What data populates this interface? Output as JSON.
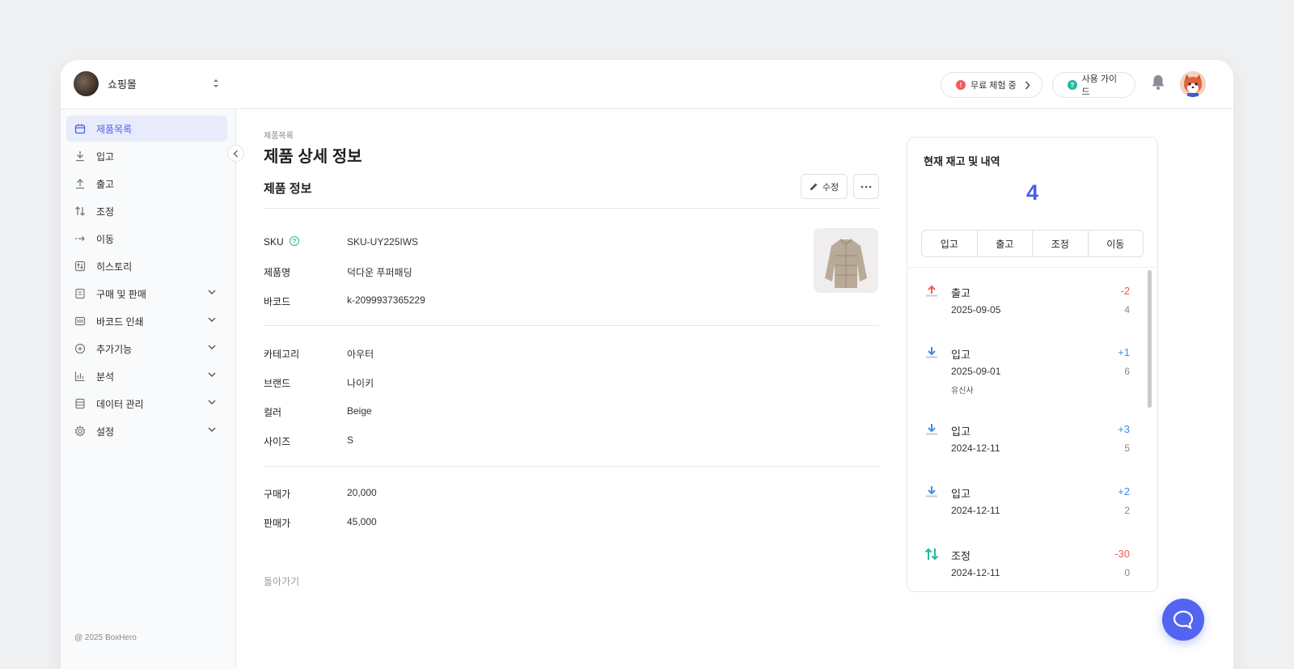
{
  "header": {
    "store_name": "쇼핑몰",
    "trial_label": "무료 체험 중",
    "guide_label": "사용 가이드"
  },
  "sidebar": {
    "items": [
      {
        "label": "제품목록",
        "icon": "box-icon"
      },
      {
        "label": "입고",
        "icon": "download-arrow-icon"
      },
      {
        "label": "출고",
        "icon": "upload-arrow-icon"
      },
      {
        "label": "조정",
        "icon": "adjust-arrows-icon"
      },
      {
        "label": "이동",
        "icon": "move-arrow-icon"
      },
      {
        "label": "히스토리",
        "icon": "history-icon"
      },
      {
        "label": "구매 및 판매",
        "icon": "document-icon"
      },
      {
        "label": "바코드 인쇄",
        "icon": "barcode-icon"
      },
      {
        "label": "추가기능",
        "icon": "plus-circle-icon"
      },
      {
        "label": "분석",
        "icon": "bar-chart-icon"
      },
      {
        "label": "데이터 관리",
        "icon": "database-icon"
      },
      {
        "label": "설정",
        "icon": "gear-icon"
      }
    ],
    "copyright": "@ 2025 BoxHero"
  },
  "main": {
    "breadcrumb": "제품목록",
    "page_title": "제품 상세 정보",
    "section_title": "제품 정보",
    "edit_label": "수정",
    "back_label": "돌아가기",
    "fields": {
      "sku": {
        "label": "SKU",
        "value": "SKU-UY225IWS"
      },
      "name": {
        "label": "제품명",
        "value": "덕다운 푸퍼패딩"
      },
      "barcode": {
        "label": "바코드",
        "value": "k-2099937365229"
      },
      "category": {
        "label": "카테고리",
        "value": "아우터"
      },
      "brand": {
        "label": "브랜드",
        "value": "나이키"
      },
      "color": {
        "label": "컬러",
        "value": "Beige"
      },
      "size": {
        "label": "사이즈",
        "value": "S"
      },
      "purchase_price": {
        "label": "구매가",
        "value": "20,000"
      },
      "sale_price": {
        "label": "판매가",
        "value": "45,000"
      }
    }
  },
  "stock": {
    "title": "현재 재고 및 내역",
    "quantity": "4",
    "actions": [
      "입고",
      "출고",
      "조정",
      "이동"
    ],
    "transactions": [
      {
        "type": "출고",
        "date": "2025-09-05",
        "delta": "-2",
        "balance": "4",
        "note": "",
        "kind": "out"
      },
      {
        "type": "입고",
        "date": "2025-09-01",
        "delta": "+1",
        "balance": "6",
        "note": "유신사",
        "kind": "in"
      },
      {
        "type": "입고",
        "date": "2024-12-11",
        "delta": "+3",
        "balance": "5",
        "note": "",
        "kind": "in"
      },
      {
        "type": "입고",
        "date": "2024-12-11",
        "delta": "+2",
        "balance": "2",
        "note": "",
        "kind": "in"
      },
      {
        "type": "조정",
        "date": "2024-12-11",
        "delta": "-30",
        "balance": "0",
        "note": "",
        "kind": "adjust"
      }
    ]
  },
  "colors": {
    "accent": "#4a5ee6",
    "negative": "#f05b5b",
    "positive": "#3d8ee8",
    "teal": "#2bb5a0"
  }
}
